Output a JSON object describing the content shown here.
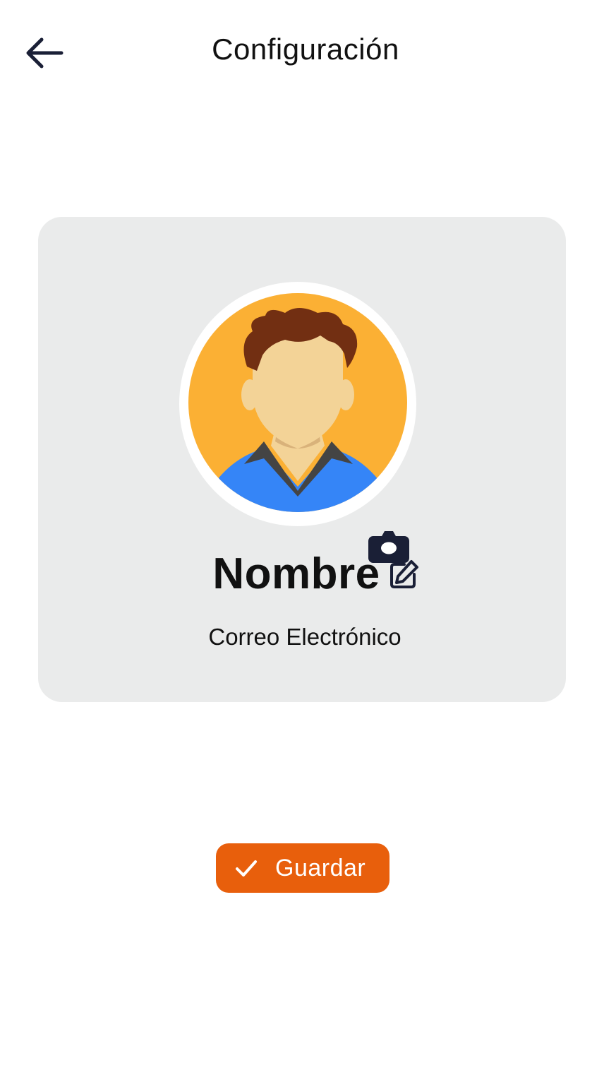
{
  "header": {
    "title": "Configuración",
    "back_icon": "arrow-left-icon"
  },
  "profile": {
    "name": "Nombre",
    "email": "Correo Electrónico",
    "avatar_icon": "user-avatar",
    "camera_icon": "camera-icon",
    "edit_icon": "edit-icon"
  },
  "actions": {
    "save_label": "Guardar",
    "save_icon": "check-icon"
  },
  "colors": {
    "accent": "#e85f0c",
    "card_background": "#eaebeb",
    "icon_dark": "#1a1f36",
    "avatar_background": "#fbb034",
    "hair": "#722f12",
    "skin": "#f3d397",
    "shirt": "#3585f7"
  }
}
